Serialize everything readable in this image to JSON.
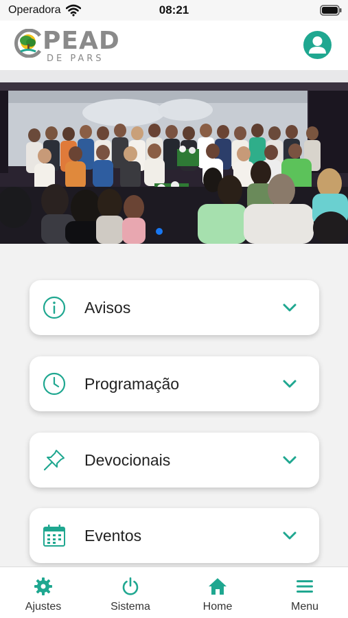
{
  "status_bar": {
    "carrier": "Operadora",
    "time": "08:21"
  },
  "header": {
    "logo_text": "PEAD",
    "logo_subtext": "DE PARS"
  },
  "colors": {
    "accent": "#1fa790",
    "page_indicator": "#1877f2"
  },
  "carousel": {
    "active_page": 1
  },
  "sections": [
    {
      "label": "Avisos",
      "icon": "info-circle-icon"
    },
    {
      "label": "Programação",
      "icon": "clock-icon"
    },
    {
      "label": "Devocionais",
      "icon": "pin-icon"
    },
    {
      "label": "Eventos",
      "icon": "calendar-icon"
    }
  ],
  "tabs": [
    {
      "label": "Ajustes",
      "icon": "gear-icon"
    },
    {
      "label": "Sistema",
      "icon": "power-icon"
    },
    {
      "label": "Home",
      "icon": "home-icon"
    },
    {
      "label": "Menu",
      "icon": "hamburger-icon"
    }
  ]
}
